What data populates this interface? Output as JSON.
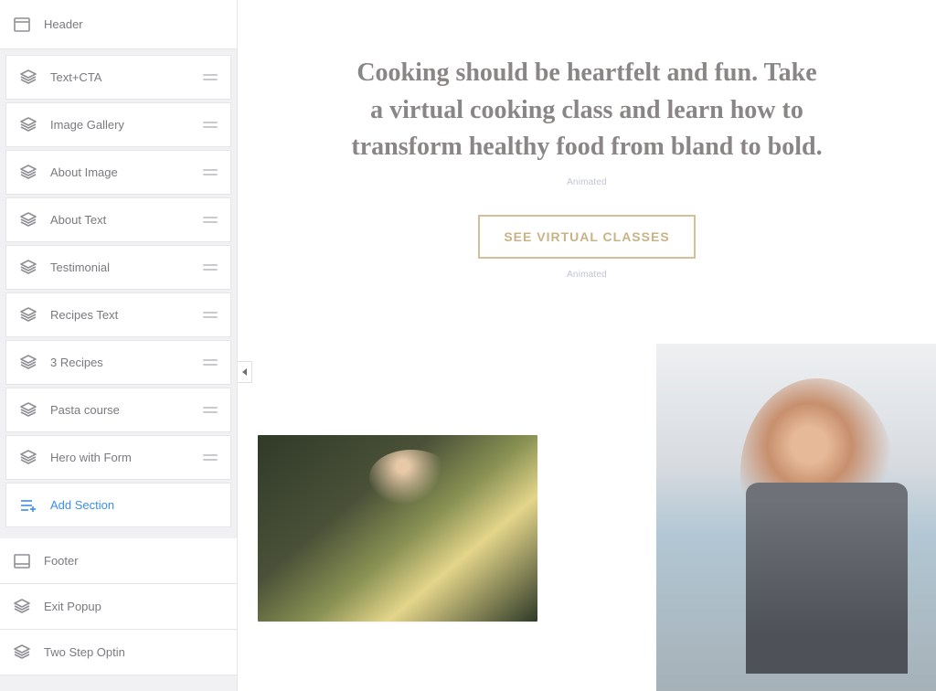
{
  "sidebar": {
    "header": {
      "label": "Header"
    },
    "sections": [
      {
        "label": "Text+CTA"
      },
      {
        "label": "Image Gallery"
      },
      {
        "label": "About Image"
      },
      {
        "label": "About Text"
      },
      {
        "label": "Testimonial"
      },
      {
        "label": "Recipes Text"
      },
      {
        "label": "3 Recipes"
      },
      {
        "label": "Pasta course"
      },
      {
        "label": "Hero with Form"
      }
    ],
    "add_section": {
      "label": "Add Section"
    },
    "fixed": [
      {
        "label": "Footer",
        "icon": "footer"
      },
      {
        "label": "Exit Popup",
        "icon": "layers"
      },
      {
        "label": "Two Step Optin",
        "icon": "layers"
      }
    ]
  },
  "canvas": {
    "heading": "Cooking should be heartfelt and fun. Take a virtual cooking class and learn how to transform healthy food from bland to bold.",
    "animated_label": "Animated",
    "cta_label": "SEE VIRTUAL CLASSES"
  }
}
